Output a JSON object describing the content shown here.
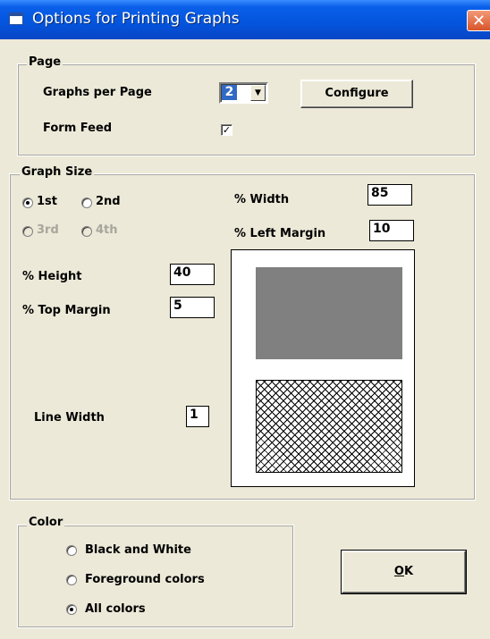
{
  "window": {
    "title": "Options for Printing Graphs",
    "close_symbol": "✕"
  },
  "page_group": {
    "legend": "Page",
    "graphs_per_page_label": "Graphs per Page",
    "graphs_per_page_value": "2",
    "configure_label": "Configure",
    "form_feed_label": "Form Feed",
    "form_feed_checked": true
  },
  "graph_size": {
    "legend": "Graph Size",
    "radios": [
      {
        "label": "1st",
        "selected": true,
        "enabled": true
      },
      {
        "label": "2nd",
        "selected": false,
        "enabled": true
      },
      {
        "label": "3rd",
        "selected": false,
        "enabled": false
      },
      {
        "label": "4th",
        "selected": false,
        "enabled": false
      }
    ],
    "width_label": "% Width",
    "width_value": "85",
    "left_margin_label": "% Left Margin",
    "left_margin_value": "10",
    "height_label": "% Height",
    "height_value": "40",
    "top_margin_label": "% Top Margin",
    "top_margin_value": "5",
    "line_width_label": "Line Width",
    "line_width_value": "1"
  },
  "color_group": {
    "legend": "Color",
    "options": [
      {
        "label": "Black and White",
        "selected": false
      },
      {
        "label": "Foreground colors",
        "selected": false
      },
      {
        "label": "All colors",
        "selected": true
      }
    ]
  },
  "ok_label": "OK",
  "ok_access_key": "O",
  "ok_rest": "K",
  "colors": {
    "titlebar": "#0454DD",
    "dialog_bg": "#ECE9D8",
    "selection": "#316AC5",
    "preview_fill": "#808080"
  }
}
